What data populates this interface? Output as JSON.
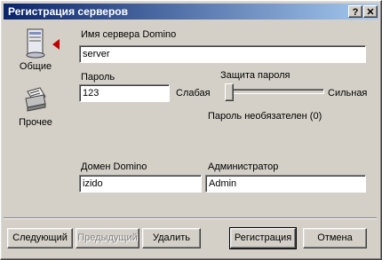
{
  "window": {
    "title": "Регистрация серверов",
    "help_glyph": "?",
    "close_glyph": "✕"
  },
  "nav": {
    "items": [
      {
        "label": "Общие",
        "icon": "server-icon",
        "selected": true
      },
      {
        "label": "Прочее",
        "icon": "printer-icon",
        "selected": false
      }
    ]
  },
  "form": {
    "server_name_label": "Имя сервера Domino",
    "server_name_value": "server",
    "password_label": "Пароль",
    "password_value": "123",
    "protection_label": "Защита пароля",
    "weak_label": "Слабая",
    "strong_label": "Сильная",
    "slider_level": 0,
    "password_note": "Пароль необязателен (0)",
    "domain_label": "Домен Domino",
    "domain_value": "izido",
    "admin_label": "Администратор",
    "admin_value": "Admin"
  },
  "buttons": {
    "next": "Следующий",
    "prev": "Предыдущий",
    "delete": "Удалить",
    "register": "Регистрация",
    "cancel": "Отмена"
  }
}
